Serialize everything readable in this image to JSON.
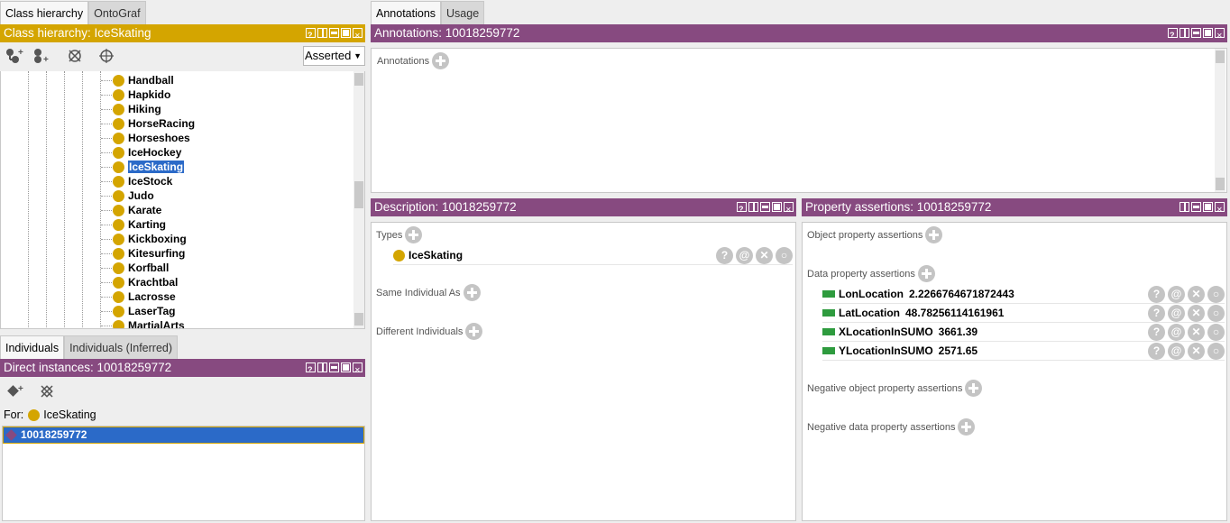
{
  "left_tabs": [
    "Class hierarchy",
    "OntoGraf"
  ],
  "class_hierarchy": {
    "title": "Class hierarchy: IceSkating",
    "mode": "Asserted",
    "items": [
      "Handball",
      "Hapkido",
      "Hiking",
      "HorseRacing",
      "Horseshoes",
      "IceHockey",
      "IceSkating",
      "IceStock",
      "Judo",
      "Karate",
      "Karting",
      "Kickboxing",
      "Kitesurfing",
      "Korfball",
      "Krachtbal",
      "Lacrosse",
      "LaserTag",
      "MartialArts"
    ],
    "selected": "IceSkating"
  },
  "individuals_tabs": [
    "Individuals",
    "Individuals (Inferred)"
  ],
  "direct_instances": {
    "title": "Direct instances: 10018259772",
    "for_label": "For:",
    "for_class": "IceSkating",
    "instance": "10018259772"
  },
  "right_tabs": [
    "Annotations",
    "Usage"
  ],
  "annotations": {
    "title": "Annotations: 10018259772",
    "label": "Annotations"
  },
  "description": {
    "title": "Description: 10018259772",
    "types_label": "Types",
    "type_value": "IceSkating",
    "same_label": "Same Individual As",
    "different_label": "Different Individuals"
  },
  "property_assertions": {
    "title": "Property assertions: 10018259772",
    "object_label": "Object property assertions",
    "data_label": "Data property assertions",
    "data": [
      {
        "prop": "LonLocation",
        "value": "2.2266764671872443"
      },
      {
        "prop": "LatLocation",
        "value": "48.78256114161961"
      },
      {
        "prop": "XLocationInSUMO",
        "value": "3661.39"
      },
      {
        "prop": "YLocationInSUMO",
        "value": "2571.65"
      }
    ],
    "neg_object_label": "Negative object property assertions",
    "neg_data_label": "Negative data property assertions"
  },
  "colors": {
    "class_header": "#d4a500",
    "view_header": "#874a80",
    "selection": "#2b6ac8",
    "data_prop": "#2e9b3e"
  }
}
